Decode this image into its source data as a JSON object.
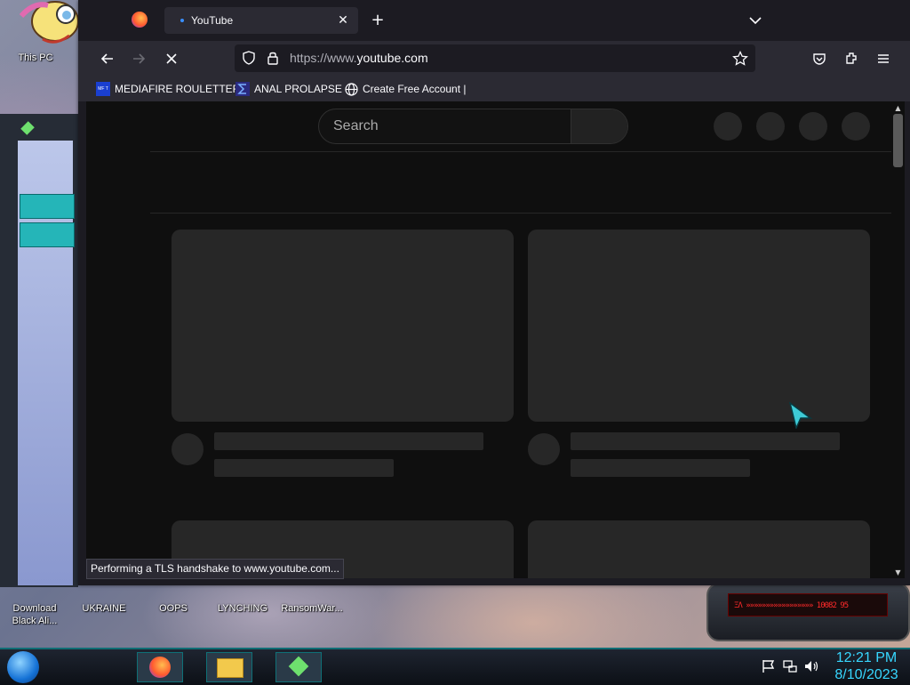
{
  "desktop": {
    "icons": [
      {
        "label": "This PC"
      },
      {
        "label": "Download Black Ali..."
      },
      {
        "label": "UKRAINE"
      },
      {
        "label": "OOPS"
      },
      {
        "label": "LYNCHING"
      },
      {
        "label": "RansomWar..."
      }
    ]
  },
  "browser": {
    "tab": {
      "title": "YouTube",
      "close_icon": "close-icon"
    },
    "new_tab_label": "+",
    "url": {
      "prefix": "https://www.",
      "domain": "youtube.com"
    },
    "bookmarks": [
      {
        "label": "MEDIAFIRE ROULETTER",
        "icon_text": "MF T"
      },
      {
        "label": "ANAL PROLAPSE"
      },
      {
        "label": "Create Free Account |"
      }
    ],
    "status_text": "Performing a TLS handshake to www.youtube.com..."
  },
  "youtube": {
    "search_placeholder": "Search"
  },
  "widget": {
    "screen_text": "ΞΛ »»»»»»»»»»»»»»»»»  10082 95"
  },
  "taskbar": {
    "time": "12:21 PM",
    "date": "8/10/2023"
  },
  "colors": {
    "browser_bg": "#1c1b22",
    "toolbar": "#2b2a33",
    "page_bg": "#0f0f0f",
    "skeleton": "#272727",
    "clock": "#37d7ff",
    "accent_cyan": "#25b5b8"
  }
}
